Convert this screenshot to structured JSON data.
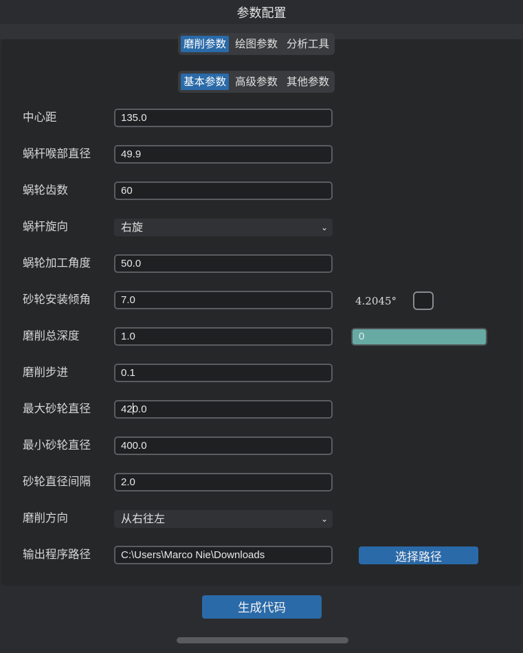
{
  "window": {
    "title": "参数配置"
  },
  "top_tabs": [
    {
      "label": "磨削参数",
      "active": true
    },
    {
      "label": "绘图参数",
      "active": false
    },
    {
      "label": "分析工具",
      "active": false
    }
  ],
  "sub_tabs": [
    {
      "label": "基本参数",
      "active": true
    },
    {
      "label": "高级参数",
      "active": false
    },
    {
      "label": "其他参数",
      "active": false
    }
  ],
  "form": {
    "center_distance": {
      "label": "中心距",
      "value": "135.0"
    },
    "worm_throat_diameter": {
      "label": "蜗杆喉部直径",
      "value": "49.9"
    },
    "worm_wheel_teeth": {
      "label": "蜗轮齿数",
      "value": "60"
    },
    "worm_hand": {
      "label": "蜗杆旋向",
      "selected": "右旋"
    },
    "worm_machining_angle": {
      "label": "蜗轮加工角度",
      "value": "50.0"
    },
    "wheel_install_tilt": {
      "label": "砂轮安装倾角",
      "value": "7.0",
      "computed": "4.2045°"
    },
    "total_grinding_depth": {
      "label": "磨削总深度",
      "value": "1.0"
    },
    "grinding_step": {
      "label": "磨削步进",
      "value": "0.1"
    },
    "max_wheel_diameter": {
      "label": "最大砂轮直径",
      "value_before_cursor": "42",
      "value_after_cursor": "0.0"
    },
    "min_wheel_diameter": {
      "label": "最小砂轮直径",
      "value": "400.0"
    },
    "wheel_diameter_interval": {
      "label": "砂轮直径间隔",
      "value": "2.0"
    },
    "grinding_direction": {
      "label": "磨削方向",
      "selected": "从右往左"
    },
    "output_path": {
      "label": "输出程序路径",
      "value": "C:\\Users\\Marco Nie\\Downloads",
      "browse_label": "选择路径"
    }
  },
  "progress": {
    "text": "0",
    "value": 0
  },
  "actions": {
    "generate_label": "生成代码"
  },
  "colors": {
    "accent": "#2a6aa8",
    "progress_fill": "#67aaa4",
    "background": "#262729"
  }
}
